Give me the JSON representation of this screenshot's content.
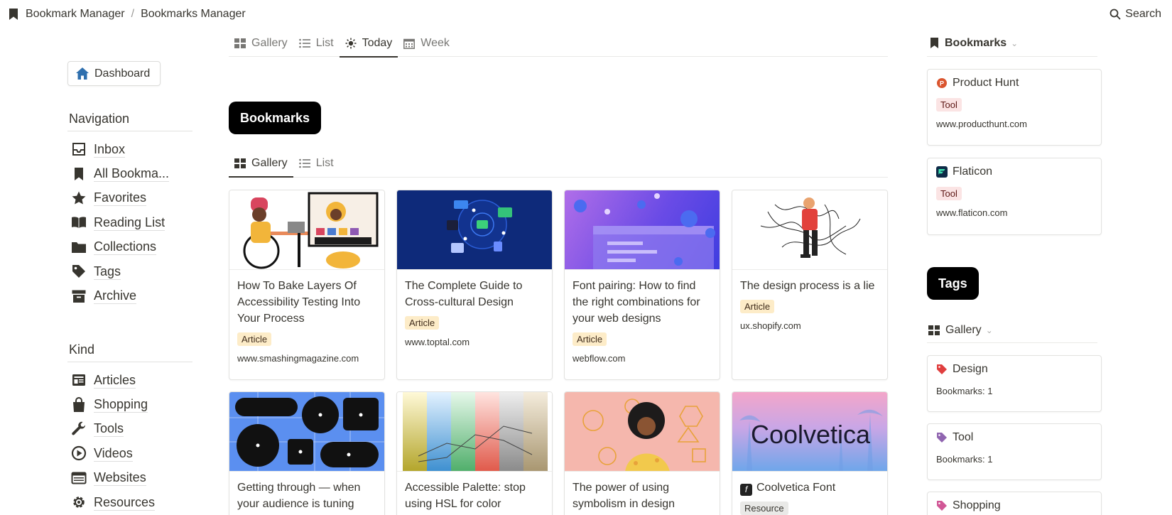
{
  "breadcrumb": {
    "root": "Bookmark Manager",
    "separator": "/",
    "current": "Bookmarks Manager"
  },
  "search_label": "Search",
  "view_tabs": [
    {
      "label": "Gallery",
      "icon": "gallery-icon"
    },
    {
      "label": "List",
      "icon": "list-icon"
    },
    {
      "label": "Today",
      "icon": "sun-icon",
      "active": true
    },
    {
      "label": "Week",
      "icon": "calendar-icon"
    }
  ],
  "sidebar": {
    "dashboard_label": "Dashboard",
    "navigation": {
      "title": "Navigation",
      "items": [
        {
          "label": "Inbox",
          "icon": "inbox-icon"
        },
        {
          "label": "All Bookma...",
          "icon": "bookmark-icon"
        },
        {
          "label": "Favorites",
          "icon": "star-icon"
        },
        {
          "label": "Reading List",
          "icon": "book-icon"
        },
        {
          "label": "Collections",
          "icon": "folder-icon"
        },
        {
          "label": "Tags",
          "icon": "tag-icon"
        },
        {
          "label": "Archive",
          "icon": "archive-icon"
        }
      ]
    },
    "kind": {
      "title": "Kind",
      "items": [
        {
          "label": "Articles",
          "icon": "newspaper-icon"
        },
        {
          "label": "Shopping",
          "icon": "shopping-bag-icon"
        },
        {
          "label": "Tools",
          "icon": "wrench-icon"
        },
        {
          "label": "Videos",
          "icon": "play-icon"
        },
        {
          "label": "Websites",
          "icon": "browser-icon"
        },
        {
          "label": "Resources",
          "icon": "gear-icon"
        }
      ]
    }
  },
  "main": {
    "heading": "Bookmarks",
    "sub_tabs": [
      {
        "label": "Gallery",
        "icon": "gallery-icon",
        "active": true
      },
      {
        "label": "List",
        "icon": "list-icon"
      }
    ],
    "cards": [
      {
        "title": "How To Bake Layers Of Accessibility Testing Into Your Process",
        "tag": "Article",
        "url": "www.smashingmagazine.com"
      },
      {
        "title": "The Complete Guide to Cross-cultural Design",
        "tag": "Article",
        "url": "www.toptal.com"
      },
      {
        "title": "Font pairing: How to find the right combinations for your web designs",
        "tag": "Article",
        "url": "webflow.com"
      },
      {
        "title": "The design process is a lie",
        "tag": "Article",
        "url": "ux.shopify.com"
      },
      {
        "title": "Getting through — when your audience is tuning",
        "tag": "",
        "url": ""
      },
      {
        "title": "Accessible Palette: stop using HSL for color",
        "tag": "",
        "url": ""
      },
      {
        "title": "The power of using symbolism in design",
        "tag": "",
        "url": ""
      },
      {
        "title": "Coolvetica Font",
        "tag": "Resource",
        "url": "",
        "thumb_text": "Coolvetica"
      }
    ]
  },
  "right": {
    "bookmarks_title": "Bookmarks",
    "bookmarks": [
      {
        "title": "Product Hunt",
        "tag": "Tool",
        "url": "www.producthunt.com",
        "icon_letter": "P"
      },
      {
        "title": "Flaticon",
        "tag": "Tool",
        "url": "www.flaticon.com"
      }
    ],
    "tags_heading": "Tags",
    "gallery_label": "Gallery",
    "tags": [
      {
        "title": "Design",
        "count": "Bookmarks: 1",
        "color": "#e03e3e"
      },
      {
        "title": "Tool",
        "count": "Bookmarks: 1",
        "color": "#9065b0"
      },
      {
        "title": "Shopping",
        "count": "",
        "color": "#d15796"
      }
    ]
  }
}
